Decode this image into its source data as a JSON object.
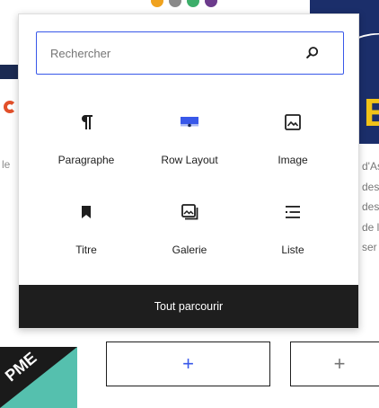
{
  "colors": {
    "accent": "#3858e9",
    "footer_bg": "#1e1e1e",
    "brand_navy": "#1b2e6a",
    "brand_yellow": "#f2c318",
    "brand_teal": "#55c0ae"
  },
  "background": {
    "left_fragment": "le",
    "right_fragment_letter": "E",
    "right_text_lines": [
      "d'As",
      "des",
      "des",
      "de l",
      "ser"
    ],
    "corner_logo_text": "PME",
    "add_block_label": "+"
  },
  "inserter": {
    "search": {
      "placeholder": "Rechercher",
      "value": ""
    },
    "blocks": [
      {
        "label": "Paragraphe",
        "icon": "paragraph-icon"
      },
      {
        "label": "Row Layout",
        "icon": "row-layout-icon"
      },
      {
        "label": "Image",
        "icon": "image-icon"
      },
      {
        "label": "Titre",
        "icon": "bookmark-icon"
      },
      {
        "label": "Galerie",
        "icon": "gallery-icon"
      },
      {
        "label": "Liste",
        "icon": "list-icon"
      }
    ],
    "browse_all_label": "Tout parcourir"
  }
}
